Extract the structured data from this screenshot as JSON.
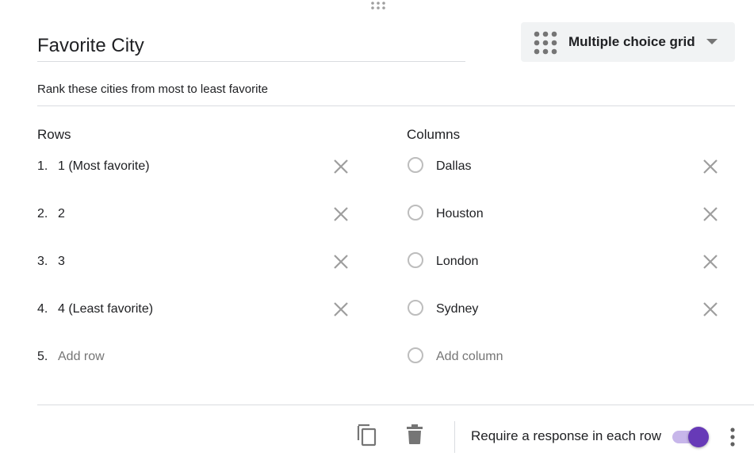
{
  "question": {
    "title": "Favorite City",
    "description": "Rank these cities from most to least favorite",
    "type_label": "Multiple choice grid"
  },
  "rows": {
    "header": "Rows",
    "items": [
      {
        "num": "1.",
        "label": "1 (Most favorite)"
      },
      {
        "num": "2.",
        "label": "2"
      },
      {
        "num": "3.",
        "label": "3"
      },
      {
        "num": "4.",
        "label": "4 (Least favorite)"
      }
    ],
    "add": {
      "num": "5.",
      "placeholder": "Add row"
    }
  },
  "columns": {
    "header": "Columns",
    "items": [
      {
        "label": "Dallas"
      },
      {
        "label": "Houston"
      },
      {
        "label": "London"
      },
      {
        "label": "Sydney"
      }
    ],
    "add": {
      "placeholder": "Add column"
    }
  },
  "footer": {
    "require_label": "Require a response in each row",
    "require_enabled": true
  },
  "colors": {
    "accent": "#673ab7",
    "accent_track": "#c7b6ea",
    "icon_gray": "#9e9e9e"
  },
  "icons": {
    "drag": "drag-handle-icon",
    "type": "grid-dots-icon",
    "remove": "close-icon",
    "duplicate": "copy-icon",
    "delete": "trash-icon",
    "more": "more-vert-icon"
  }
}
